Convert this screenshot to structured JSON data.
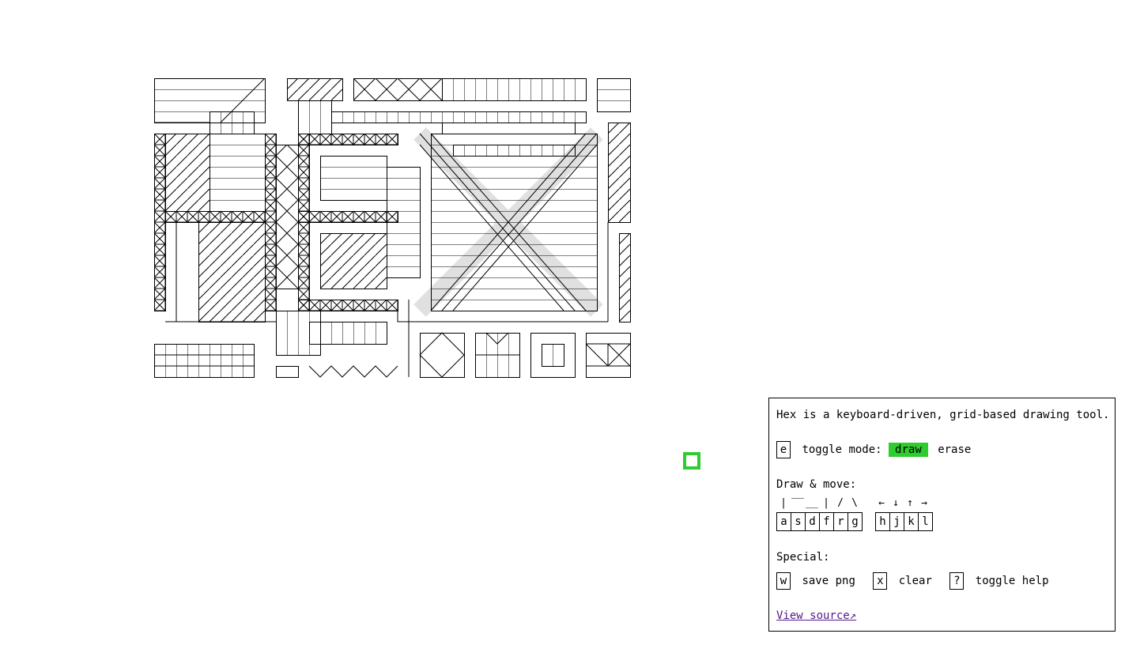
{
  "canvas": {
    "name": "hex-drawing"
  },
  "help": {
    "intro": "Hex is a keyboard-driven, grid-based drawing tool.",
    "toggle_key": "e",
    "toggle_label": "toggle mode:",
    "mode_draw": "draw",
    "mode_erase": "erase",
    "draw_move_heading": "Draw & move:",
    "draw_glyphs": [
      "|",
      "‾‾",
      "__",
      "|",
      "/",
      "\\"
    ],
    "draw_keys": [
      "a",
      "s",
      "d",
      "f",
      "r",
      "g"
    ],
    "move_glyphs": [
      "←",
      "↓",
      "↑",
      "→"
    ],
    "move_keys": [
      "h",
      "j",
      "k",
      "l"
    ],
    "special_heading": "Special:",
    "save_key": "w",
    "save_label": "save png",
    "clear_key": "x",
    "clear_label": "clear",
    "help_key": "?",
    "help_label": "toggle help",
    "source_link": "View source↗"
  },
  "colors": {
    "accent": "#2ecc2e",
    "ink": "#000000",
    "link": "#551a8b"
  }
}
